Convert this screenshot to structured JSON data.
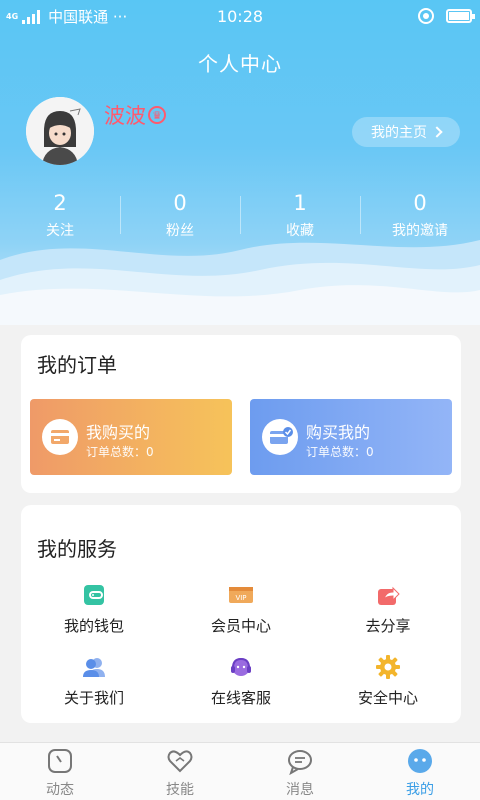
{
  "status_bar": {
    "network": "4G",
    "carrier": "中国联通 ···",
    "time": "10:28"
  },
  "header": {
    "title": "个人中心"
  },
  "profile": {
    "username": "波波",
    "homepage_label": "我的主页"
  },
  "stats": [
    {
      "value": "2",
      "label": "关注"
    },
    {
      "value": "0",
      "label": "粉丝"
    },
    {
      "value": "1",
      "label": "收藏"
    },
    {
      "value": "0",
      "label": "我的邀请"
    }
  ],
  "orders": {
    "title": "我的订单",
    "bought": {
      "label": "我购买的",
      "count": "订单总数：0"
    },
    "sold": {
      "label": "购买我的",
      "count": "订单总数：0"
    }
  },
  "services": {
    "title": "我的服务",
    "items": [
      {
        "label": "我的钱包",
        "icon": "wallet-icon"
      },
      {
        "label": "会员中心",
        "icon": "vip-icon"
      },
      {
        "label": "去分享",
        "icon": "share-icon"
      },
      {
        "label": "关于我们",
        "icon": "about-users-icon"
      },
      {
        "label": "在线客服",
        "icon": "headset-icon"
      },
      {
        "label": "安全中心",
        "icon": "security-gear-icon"
      }
    ]
  },
  "tabbar": {
    "items": [
      {
        "label": "动态",
        "icon": "clock-icon"
      },
      {
        "label": "技能",
        "icon": "heart-icon"
      },
      {
        "label": "消息",
        "icon": "message-icon"
      },
      {
        "label": "我的",
        "icon": "profile-face-icon"
      }
    ],
    "active": "我的"
  },
  "colors": {
    "accent": "#3a9ee6",
    "username": "#ff5a6e",
    "order_bought": "#ef9a68",
    "order_sold": "#6d9cef"
  }
}
